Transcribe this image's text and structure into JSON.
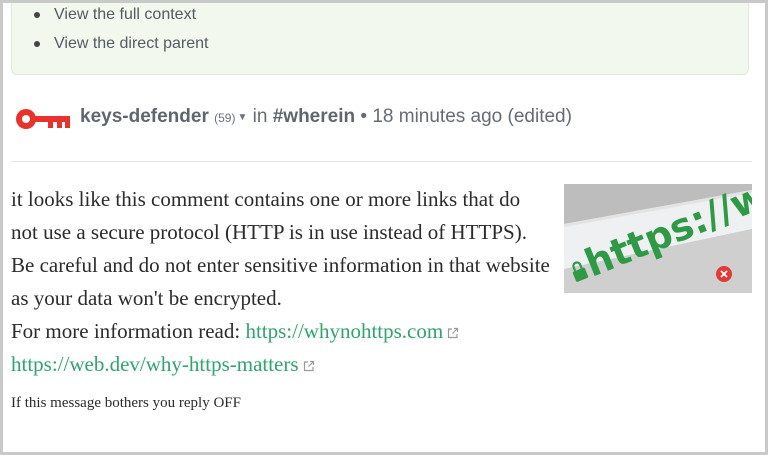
{
  "context": {
    "items": [
      "View the full context",
      "View the direct parent"
    ]
  },
  "post": {
    "author": "keys-defender",
    "reputation": "(59)",
    "in_label": "in",
    "community": "#wherein",
    "separator": "•",
    "time": "18 minutes ago (edited)"
  },
  "body": {
    "paragraph": "it looks like this comment contains one or more links that do not use a secure protocol (HTTP is in use instead of HTTPS). Be careful and do not enter sensitive information in that website as your data won't be encrypted.",
    "more_info_label": "For more information read:",
    "link1": "https://whynohttps.com",
    "link2": "https://web.dev/why-https-matters",
    "footer": "If this message bothers you reply OFF"
  },
  "thumbnail": {
    "text": "https://w"
  },
  "colors": {
    "key_icon": "#e8322c",
    "link": "#2ea56b",
    "context_bg": "#f3f8ef"
  }
}
